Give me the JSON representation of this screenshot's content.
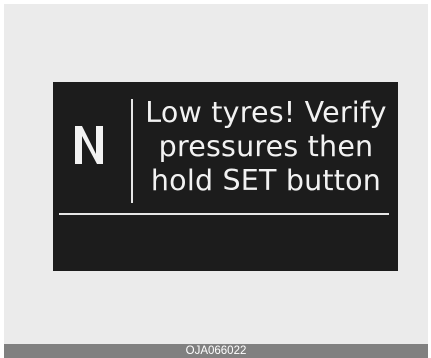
{
  "display": {
    "gear_indicator_icon": "gear-n-indicator",
    "message_lines": [
      "Low tyres! Verify",
      "pressures then",
      "hold SET button"
    ]
  },
  "footer": {
    "code": "OJA066022"
  },
  "colors": {
    "panel_background": "#1c1c1c",
    "text": "#f2f2f2",
    "frame_background": "#ebebeb",
    "footer_background": "#808080"
  }
}
